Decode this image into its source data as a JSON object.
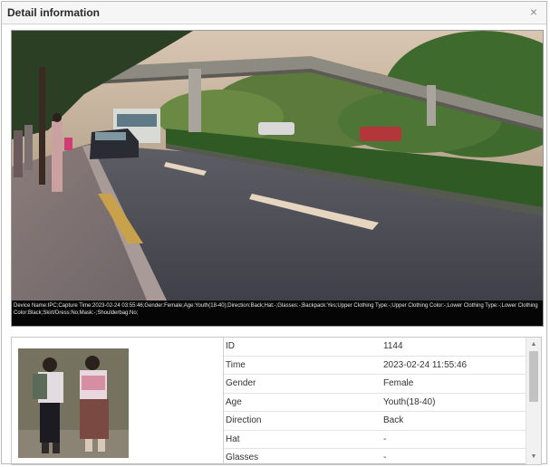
{
  "dialog": {
    "title": "Detail information",
    "close_glyph": "×"
  },
  "capture": {
    "caption": "Device Name:IPC;Capture Time:2023-02-24 03:55:46;Gender:Female;Age:Youth(18-40);Direction:Back;Hat:-;Glasses:-;Backpack:Yes;Upper Clothing Type:-;Upper Clothing Color:-;Lower Clothing Type:-;Lower Clothing Color:Black;Skirt/Dress:No;Mask:-;Shoulderbag:No;"
  },
  "details": {
    "rows": [
      {
        "key": "ID",
        "value": "1144"
      },
      {
        "key": "Time",
        "value": "2023-02-24 11:55:46"
      },
      {
        "key": "Gender",
        "value": "Female"
      },
      {
        "key": "Age",
        "value": "Youth(18-40)"
      },
      {
        "key": "Direction",
        "value": "Back"
      },
      {
        "key": "Hat",
        "value": "-"
      },
      {
        "key": "Glasses",
        "value": "-"
      }
    ]
  },
  "scrollbar": {
    "up_glyph": "▲",
    "down_glyph": "▼"
  }
}
